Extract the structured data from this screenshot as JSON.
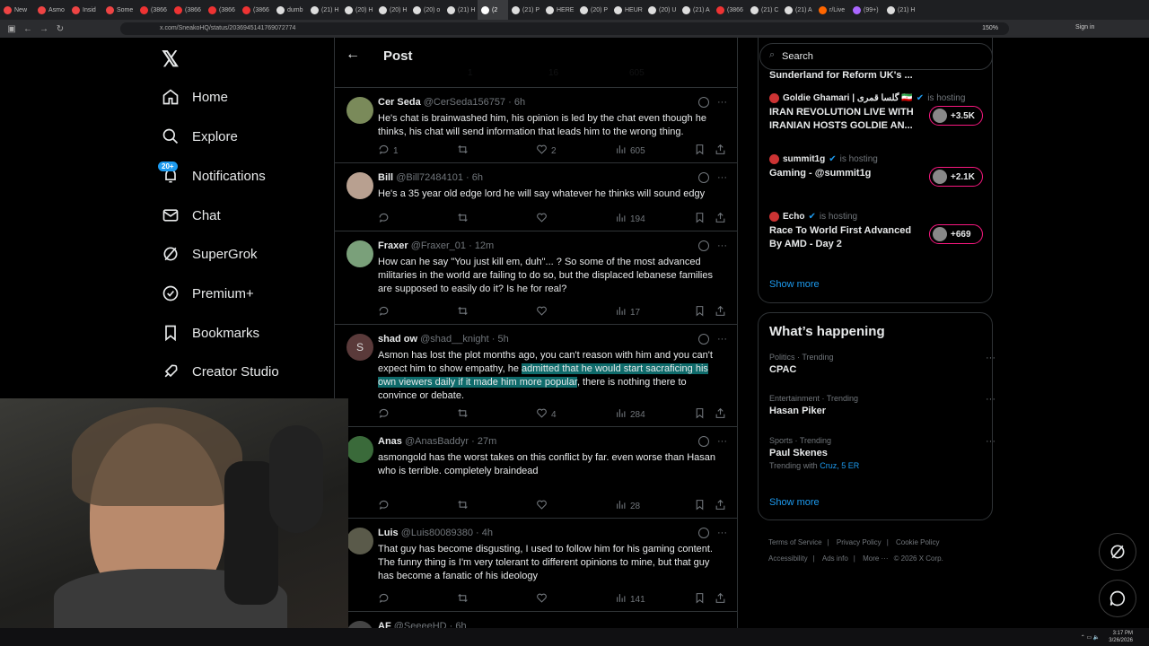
{
  "browser": {
    "tabs": [
      {
        "label": "New",
        "color": "#e44"
      },
      {
        "label": "Asmo",
        "color": "#e44"
      },
      {
        "label": "Insid",
        "color": "#e44"
      },
      {
        "label": "Some",
        "color": "#e44"
      },
      {
        "label": "(3866",
        "color": "#e33"
      },
      {
        "label": "(3866",
        "color": "#e33"
      },
      {
        "label": "(3866",
        "color": "#e33"
      },
      {
        "label": "(3866",
        "color": "#e33"
      },
      {
        "label": "dumb",
        "color": "#ddd"
      },
      {
        "label": "(21) H",
        "color": "#ddd"
      },
      {
        "label": "(20) H",
        "color": "#ddd"
      },
      {
        "label": "(20) H",
        "color": "#ddd"
      },
      {
        "label": "(20) o",
        "color": "#ddd"
      },
      {
        "label": "(21) H",
        "color": "#ddd"
      },
      {
        "label": "(2",
        "color": "#fff"
      },
      {
        "label": "(21) P",
        "color": "#ddd"
      },
      {
        "label": "HERE",
        "color": "#ddd"
      },
      {
        "label": "(20) P",
        "color": "#ddd"
      },
      {
        "label": "HEUR",
        "color": "#ddd"
      },
      {
        "label": "(20) U",
        "color": "#ddd"
      },
      {
        "label": "(21) A",
        "color": "#ddd"
      },
      {
        "label": "(3866",
        "color": "#e33"
      },
      {
        "label": "(21) C",
        "color": "#ddd"
      },
      {
        "label": "(21) A",
        "color": "#ddd"
      },
      {
        "label": "r/Live",
        "color": "#f60"
      },
      {
        "label": "(99+)",
        "color": "#a6f"
      },
      {
        "label": "(21) H",
        "color": "#ddd"
      }
    ],
    "url": "x.com/SneakoHQ/status/2036945141769072774",
    "zoom": "150%",
    "sign_in": "Sign in"
  },
  "nav": {
    "home": "Home",
    "explore": "Explore",
    "notifications": "Notifications",
    "notif_badge": "20+",
    "chat": "Chat",
    "supergrok": "SuperGrok",
    "premium": "Premium+",
    "bookmarks": "Bookmarks",
    "creator_studio": "Creator Studio"
  },
  "header": {
    "title": "Post"
  },
  "prev_counts": {
    "reply": "1",
    "like": "16",
    "views": "605"
  },
  "tweets": [
    {
      "name": "Cer Seda",
      "handle": "@CerSeda156757",
      "time": "6h",
      "text": "He's chat is brainwashed him, his opinion is led by the chat even though he thinks, his chat will send information that leads him to the wrong thing.",
      "replies": "1",
      "retweets": "",
      "likes": "2",
      "views": "605",
      "avatar_color": "#7a8a5a"
    },
    {
      "name": "Bill",
      "handle": "@Bill72484101",
      "time": "6h",
      "text": "He's a 35 year old edge lord he will say whatever he thinks will sound edgy",
      "replies": "",
      "retweets": "",
      "likes": "",
      "views": "194",
      "avatar_color": "#b8a090"
    },
    {
      "name": "Fraxer",
      "handle": "@Fraxer_01",
      "time": "12m",
      "text": "How can he say \"You just kill em, duh\"... ? So some of the most advanced militaries in the world are failing to do so, but the displaced lebanese families are supposed to easily do it? Is he for real?",
      "replies": "",
      "retweets": "",
      "likes": "",
      "views": "17",
      "avatar_color": "#7aa07a"
    },
    {
      "name": "shad ow",
      "handle": "@shad__knight",
      "time": "5h",
      "text_before": "Asmon has lost the plot months ago, you can't reason with him and you can't expect him to show empathy, he ",
      "text_highlight": "admitted that he would start sacraficing his own viewers daily if it made him more popular",
      "text_after": ", there is nothing there to convince or debate.",
      "avatar_letter": "S",
      "replies": "",
      "retweets": "",
      "likes": "4",
      "views": "284",
      "avatar_color": "#5a3a3a"
    },
    {
      "name": "Anas",
      "handle": "@AnasBaddyr",
      "time": "27m",
      "text": "asmongold has the worst takes on this conflict by far. even worse than Hasan who is terrible. completely braindead",
      "replies": "",
      "retweets": "",
      "likes": "",
      "views": "28",
      "avatar_color": "#3a6a3a"
    },
    {
      "name": "Luis",
      "handle": "@Luis80089380",
      "time": "4h",
      "text": "That guy has become disgusting, I used to follow him for his gaming content. The funny thing is I'm very tolerant to different opinions to mine, but that guy has become a fanatic of his ideology",
      "replies": "",
      "retweets": "",
      "likes": "",
      "views": "141",
      "avatar_color": "#5a5a4a"
    }
  ],
  "last_partial": {
    "name": "AF",
    "handle": "@SeeeeHD",
    "time": "6h"
  },
  "search": {
    "placeholder": "Search"
  },
  "live": {
    "top_partial": "Sunderland for Reform UK's ...",
    "items": [
      {
        "host": "Goldie Ghamari | گلسا قمری 🇮🇷",
        "status": "is hosting",
        "title": "IRAN REVOLUTION LIVE WITH IRANIAN HOSTS GOLDIE AN...",
        "count": "+3.5K",
        "verified": true
      },
      {
        "host": "summit1g",
        "status": "is hosting",
        "title": "Gaming - @summit1g",
        "count": "+2.1K",
        "verified": true
      },
      {
        "host": "Echo",
        "status": "is hosting",
        "title": "Race To World First Advanced By AMD - Day 2",
        "count": "+669",
        "verified": true
      }
    ],
    "show_more": "Show more"
  },
  "happening": {
    "title": "What’s happening",
    "trends": [
      {
        "category": "Politics · Trending",
        "name": "CPAC",
        "sub": ""
      },
      {
        "category": "Entertainment · Trending",
        "name": "Hasan Piker",
        "sub": ""
      },
      {
        "category": "Sports · Trending",
        "name": "Paul Skenes",
        "sub": "Trending with",
        "sub_link": "Cruz, 5 ER"
      }
    ],
    "show_more": "Show more"
  },
  "footer": {
    "links": [
      "Terms of Service",
      "Privacy Policy",
      "Cookie Policy",
      "Accessibility",
      "Ads info",
      "More ···"
    ],
    "copyright": "© 2026 X Corp."
  },
  "taskbar": {
    "time": "3:17 PM",
    "date": "3/26/2026"
  },
  "colors": {
    "accent": "#1d9bf0",
    "live": "#f91880",
    "highlight": "#0f6b6b"
  }
}
